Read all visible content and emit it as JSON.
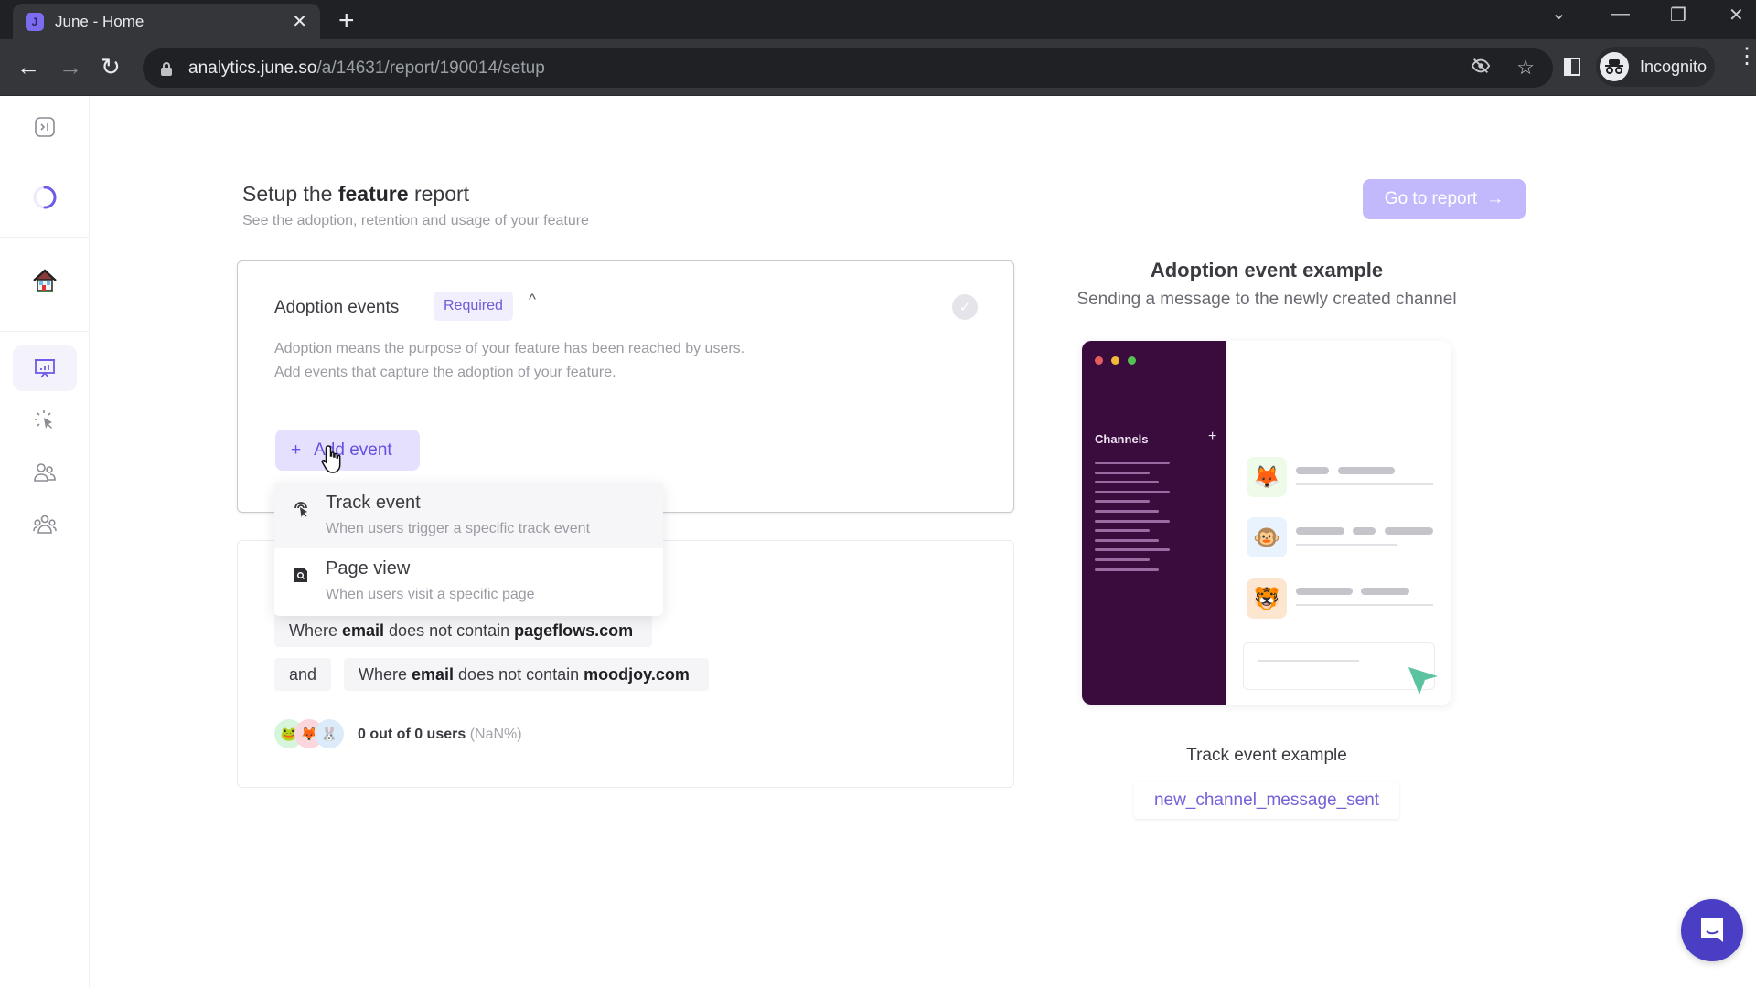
{
  "browser": {
    "tab_title": "June - Home",
    "tab_favicon": "june-logo",
    "url_host": "analytics.june.so",
    "url_path": "/a/14631/report/190014/setup",
    "profile_label": "Incognito"
  },
  "sidebar": {
    "items": [
      {
        "name": "expand-sidebar",
        "icon": "expand-sidebar-icon"
      },
      {
        "name": "loading",
        "icon": "loading-spinner-icon"
      },
      {
        "name": "home",
        "icon": "house-icon"
      },
      {
        "name": "reports",
        "icon": "presentation-chart-icon",
        "active": true
      },
      {
        "name": "events",
        "icon": "click-cursor-icon"
      },
      {
        "name": "people",
        "icon": "users-icon"
      },
      {
        "name": "companies",
        "icon": "groups-icon"
      }
    ]
  },
  "header": {
    "title_prefix": "Setup the",
    "title_bold": "feature",
    "title_suffix": "report",
    "subtitle": "See the adoption, retention and usage of your feature",
    "go_to_report_label": "Go to report",
    "go_to_report_arrow": "→"
  },
  "adoption_card": {
    "heading": "Adoption events",
    "badge": "Required",
    "chevron": "^",
    "description_lines": [
      "Adoption means the purpose of your feature has been reached by users.",
      "Add events that capture the adoption of your feature."
    ],
    "add_event_label": "Add event",
    "add_event_icon": "+"
  },
  "dropdown": {
    "items": [
      {
        "title": "Track event",
        "subtitle": "When users trigger a specific track event",
        "icon": "track-event-icon"
      },
      {
        "title": "Page view",
        "subtitle": "When users visit a specific page",
        "icon": "page-view-icon"
      }
    ]
  },
  "filters_card": {
    "filters": [
      {
        "connector": "",
        "prefix": "Where",
        "field": "email",
        "op": "does not contain",
        "value": "pageflows.com"
      },
      {
        "connector": "and",
        "prefix": "Where",
        "field": "email",
        "op": "does not contain",
        "value": "moodjoy.com"
      }
    ],
    "users_count": "0 out of 0 users",
    "users_pct": "(NaN%)"
  },
  "example": {
    "title": "Adoption event example",
    "subtitle": "Sending a message to the newly created channel",
    "mock_channels_label": "Channels",
    "mock_plus": "+",
    "track_label": "Track event example",
    "event_name": "new_channel_message_sent"
  },
  "colors": {
    "accent": "#6450e0",
    "accent_light": "#e4e0fd",
    "button_disabled": "#c1b9fb",
    "mock_sidebar": "#3a0c3e",
    "chat_launcher": "#4a3fc4"
  }
}
